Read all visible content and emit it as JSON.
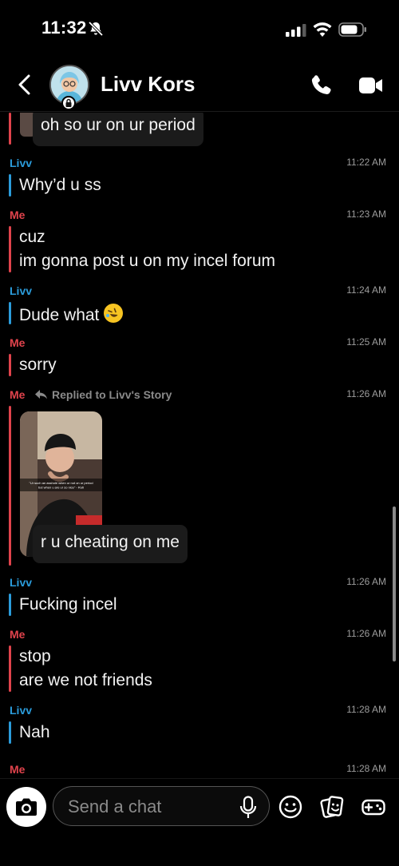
{
  "status_bar": {
    "time": "11:32"
  },
  "header": {
    "contact_name": "Livv Kors"
  },
  "messages": [
    {
      "text": "oh so ur on ur period"
    },
    {
      "sender": "Livv",
      "time": "11:22 AM",
      "text": "Why’d u ss"
    },
    {
      "sender": "Me",
      "time": "11:23 AM",
      "lines": [
        "cuz",
        "im gonna post u on my incel forum"
      ]
    },
    {
      "sender": "Livv",
      "time": "11:24 AM",
      "text": "Dude what"
    },
    {
      "sender": "Me",
      "time": "11:25 AM",
      "text": "sorry"
    },
    {
      "sender": "Me",
      "reply_label": "Replied to Livv's Story",
      "time": "11:26 AM",
      "snap_caption": "\"Ur such an asshole when ur not on ur period but when u are ur so nice\" - Ruti",
      "text": "r u cheating on me"
    },
    {
      "sender": "Livv",
      "time": "11:26 AM",
      "text": "Fucking incel"
    },
    {
      "sender": "Me",
      "time": "11:26 AM",
      "lines": [
        "stop",
        "are we not friends"
      ]
    },
    {
      "sender": "Livv",
      "time": "11:28 AM",
      "text": "Nah"
    },
    {
      "sender": "Me",
      "time": "11:28 AM"
    }
  ],
  "footer": {
    "placeholder": "Send a chat"
  },
  "icons": {
    "bell": "bell-slash-icon",
    "signal": "cellular-signal-icon",
    "wifi": "wifi-icon",
    "battery": "battery-icon",
    "back": "chevron-left-icon",
    "call": "phone-icon",
    "video": "video-camera-icon",
    "reply": "reply-arrow-icon",
    "emoji": "rolling-on-floor-laughing-emoji",
    "camera": "camera-icon",
    "mic": "microphone-icon",
    "sticker": "smiley-icon",
    "memories": "cards-icon",
    "games": "game-controller-icon"
  },
  "colors": {
    "me": "#e0434c",
    "them": "#2b9cdb",
    "background": "#000000",
    "bubble": "#1b1b1b"
  }
}
